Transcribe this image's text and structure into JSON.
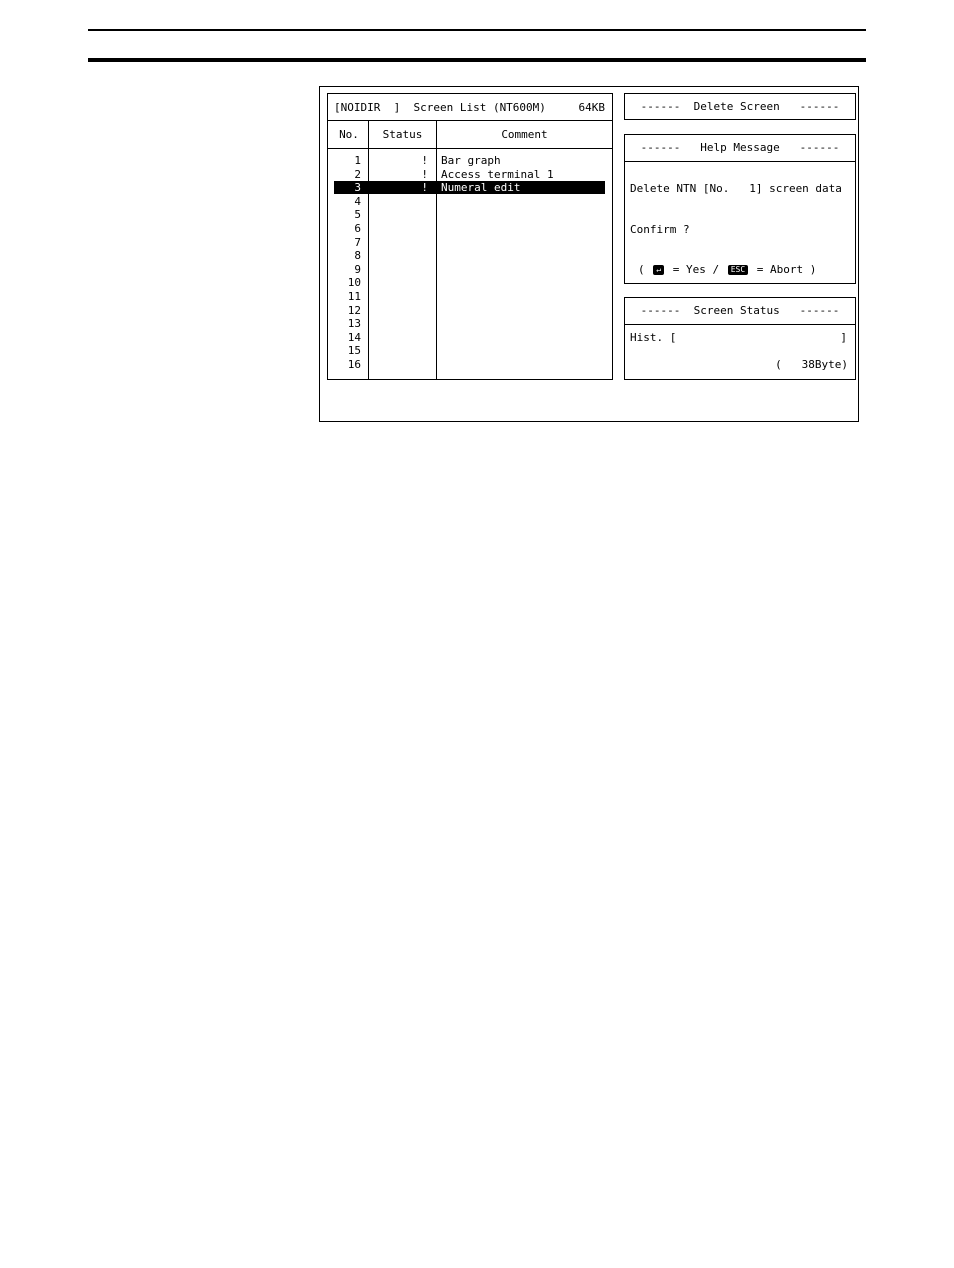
{
  "list": {
    "title": "[NOIDIR  ]  Screen List (NT600M)",
    "size": "64KB",
    "columns": {
      "no": "No.",
      "status": "Status",
      "comment": "Comment"
    },
    "rows": [
      {
        "no": "1",
        "status": "!",
        "comment": "Bar graph",
        "selected": false
      },
      {
        "no": "2",
        "status": "!",
        "comment": "Access terminal 1",
        "selected": false
      },
      {
        "no": "3",
        "status": "!",
        "comment": "Numeral edit",
        "selected": true
      },
      {
        "no": "4",
        "status": "",
        "comment": "",
        "selected": false
      },
      {
        "no": "5",
        "status": "",
        "comment": "",
        "selected": false
      },
      {
        "no": "6",
        "status": "",
        "comment": "",
        "selected": false
      },
      {
        "no": "7",
        "status": "",
        "comment": "",
        "selected": false
      },
      {
        "no": "8",
        "status": "",
        "comment": "",
        "selected": false
      },
      {
        "no": "9",
        "status": "",
        "comment": "",
        "selected": false
      },
      {
        "no": "10",
        "status": "",
        "comment": "",
        "selected": false
      },
      {
        "no": "11",
        "status": "",
        "comment": "",
        "selected": false
      },
      {
        "no": "12",
        "status": "",
        "comment": "",
        "selected": false
      },
      {
        "no": "13",
        "status": "",
        "comment": "",
        "selected": false
      },
      {
        "no": "14",
        "status": "",
        "comment": "",
        "selected": false
      },
      {
        "no": "15",
        "status": "",
        "comment": "",
        "selected": false
      },
      {
        "no": "16",
        "status": "",
        "comment": "",
        "selected": false
      }
    ]
  },
  "delete_panel": {
    "title": "------  Delete Screen   ------"
  },
  "help_panel": {
    "title": "------   Help Message   ------",
    "line1": "Delete NTN [No.   1] screen data",
    "line2": "Confirm ?",
    "open": "(",
    "enter_key": "↵",
    "yes": "= Yes /",
    "esc_key": "ESC",
    "abort": "= Abort )"
  },
  "status_panel": {
    "title": "------  Screen Status   ------",
    "hist_label": "Hist. [",
    "hist_close": "]",
    "bytes": "(   38Byte)"
  }
}
